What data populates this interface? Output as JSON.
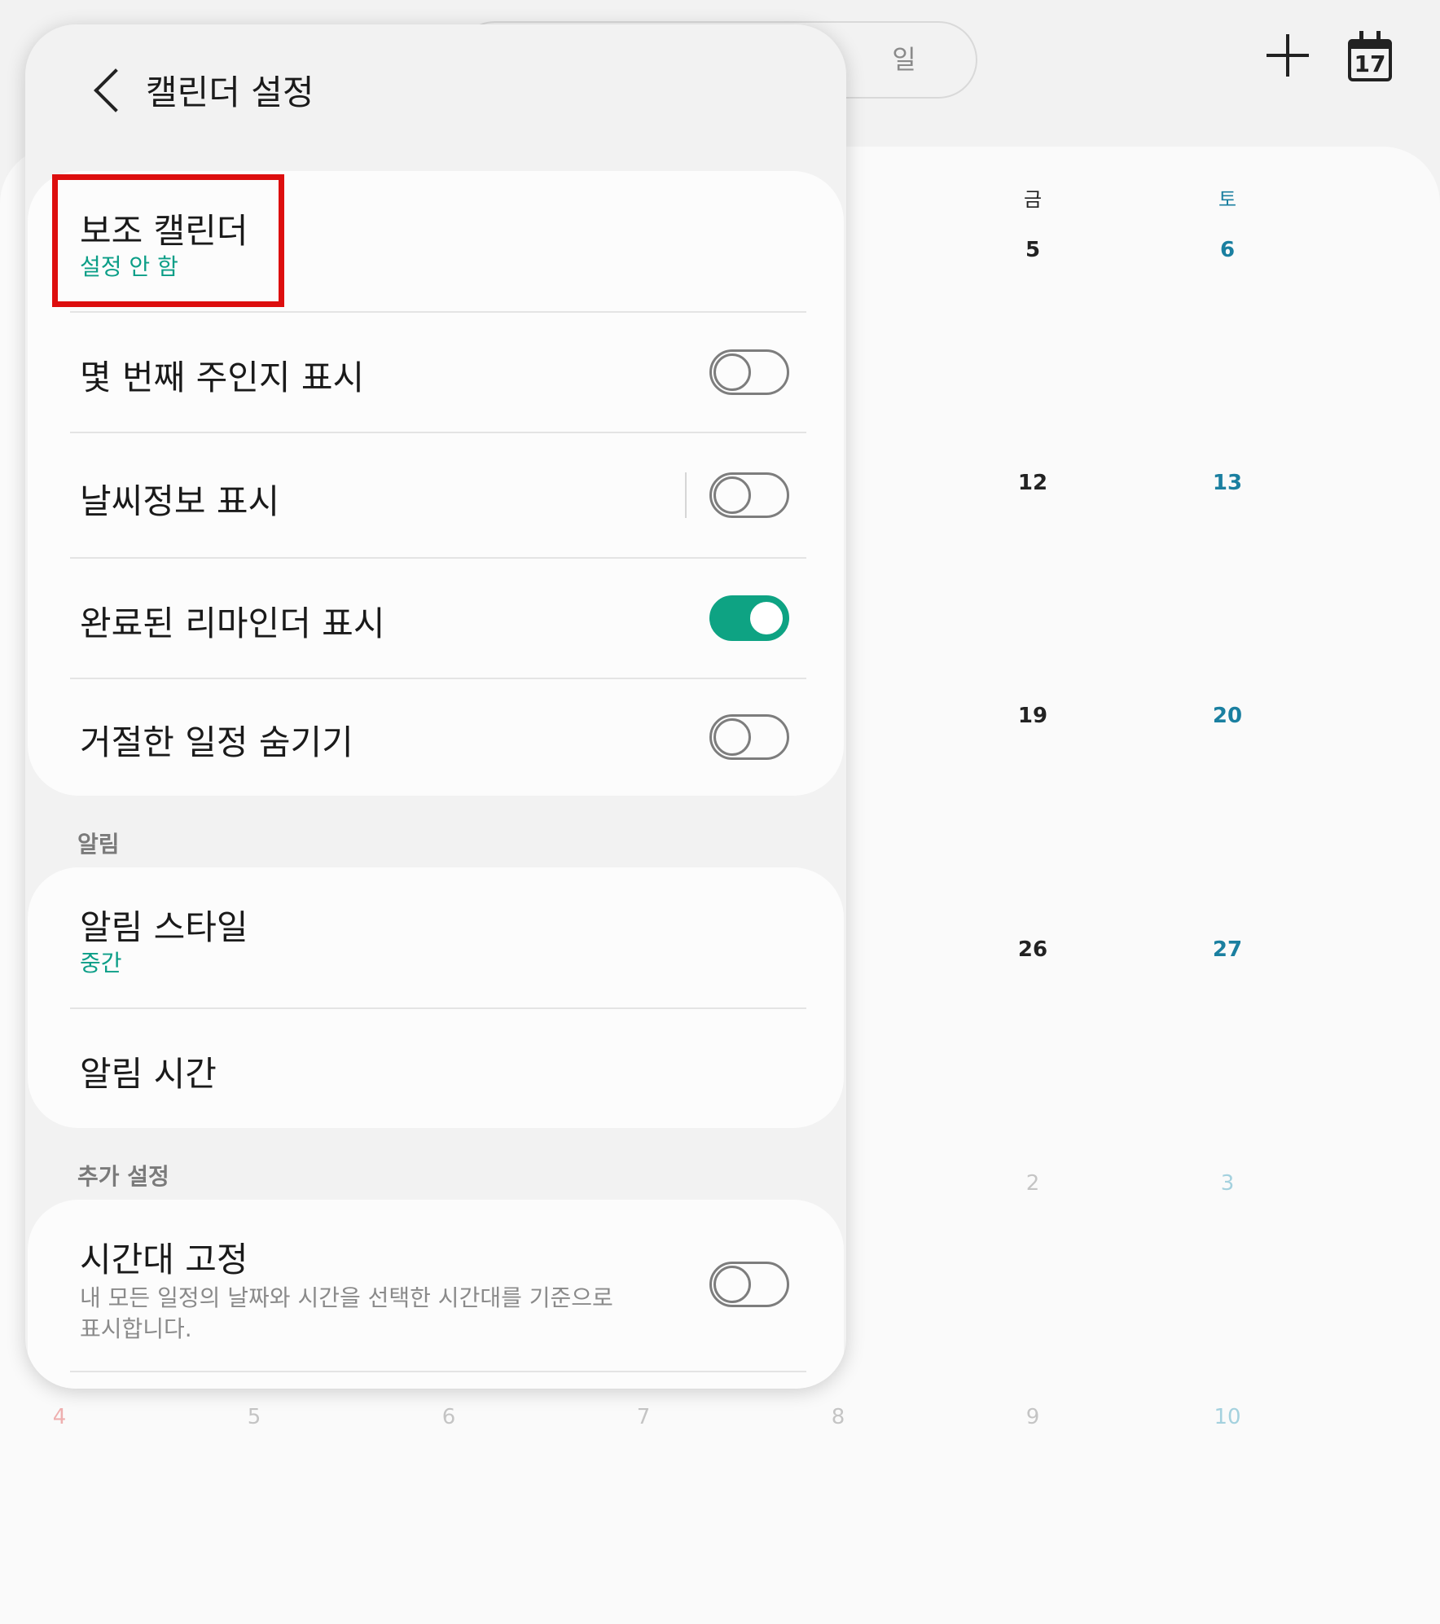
{
  "calendar": {
    "view_option": "일",
    "header_days": [
      "금",
      "토"
    ],
    "rows": [
      {
        "fri": "5",
        "sat": "6"
      },
      {
        "fri": "12",
        "sat": "13"
      },
      {
        "fri": "19",
        "sat": "20"
      },
      {
        "fri": "26",
        "sat": "27"
      },
      {
        "fri": "2",
        "sat": "3"
      }
    ],
    "last_row": [
      "4",
      "5",
      "6",
      "7",
      "8",
      "9",
      "10"
    ],
    "today_icon_day": "17",
    "colors": {
      "saturday": "#1a7fa0",
      "sunday": "#e57373",
      "weekday": "#222222"
    }
  },
  "settings": {
    "title": "캘린더 설정",
    "display_section": {
      "alt_calendar_label": "보조 캘린더",
      "alt_calendar_value": "설정 안 함",
      "week_number_label": "몇 번째 주인지 표시",
      "week_number_on": false,
      "weather_label": "날씨정보 표시",
      "weather_on": false,
      "completed_reminders_label": "완료된 리마인더 표시",
      "completed_reminders_on": true,
      "hide_declined_label": "거절한 일정 숨기기",
      "hide_declined_on": false
    },
    "alerts_section": {
      "header": "알림",
      "style_label": "알림 스타일",
      "style_value": "중간",
      "time_label": "알림 시간"
    },
    "extra_section": {
      "header": "추가 설정",
      "lock_tz_label": "시간대 고정",
      "lock_tz_desc": "내 모든 일정의 날짜와 시간을 선택한 시간대를 기준으로 표시합니다.",
      "lock_tz_on": false
    },
    "accent_color": "#0ea383",
    "highlight_color": "#dd0e0e"
  }
}
